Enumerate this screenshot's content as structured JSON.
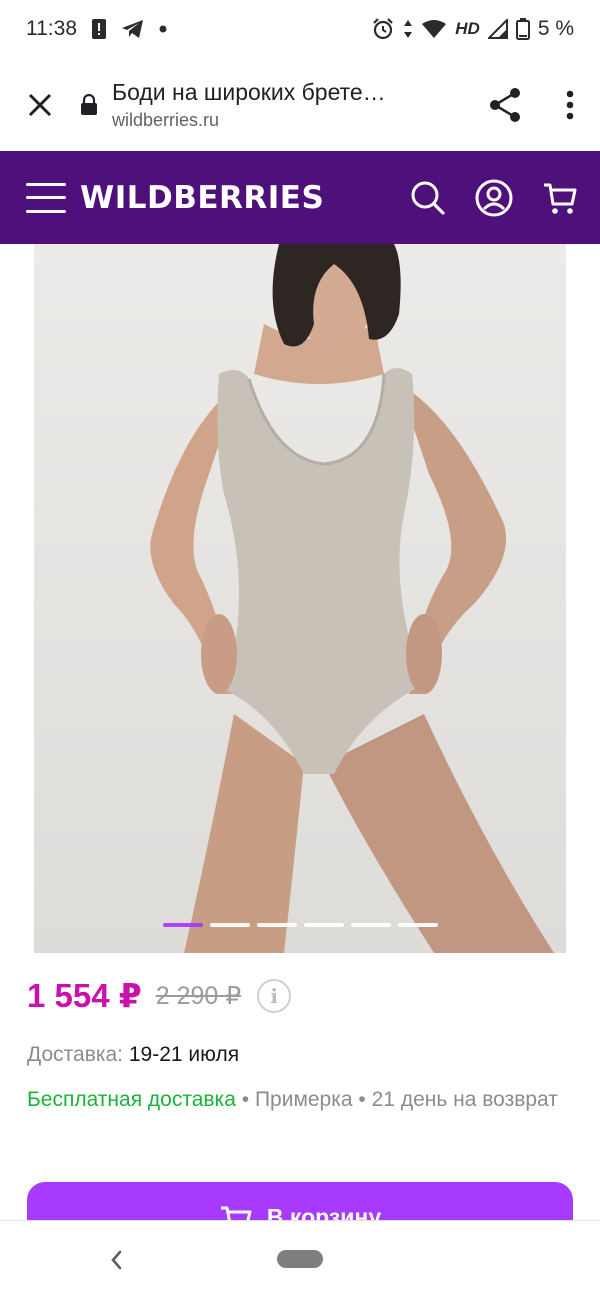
{
  "status": {
    "time": "11:38",
    "network": "HD",
    "battery": "5 %"
  },
  "browser": {
    "page_title": "Боди на широких брете…",
    "domain": "wildberries.ru"
  },
  "header": {
    "logo": "WILDBERRIES"
  },
  "product": {
    "slide_count": 6,
    "active_slide": 1,
    "price": "1 554 ₽",
    "old_price": "2 290 ₽",
    "info_icon_glyph": "i",
    "delivery_label": "Доставка:",
    "delivery_value": "19-21 июля",
    "free_delivery": "Бесплатная доставка",
    "fitting": "Примерка",
    "returns": "21 день на возврат",
    "separator": "•",
    "cart_button": "В корзину"
  },
  "colors": {
    "brand": "#4e107a",
    "accent": "#a73afd",
    "price": "#cb11ab",
    "green": "#19b33b"
  }
}
